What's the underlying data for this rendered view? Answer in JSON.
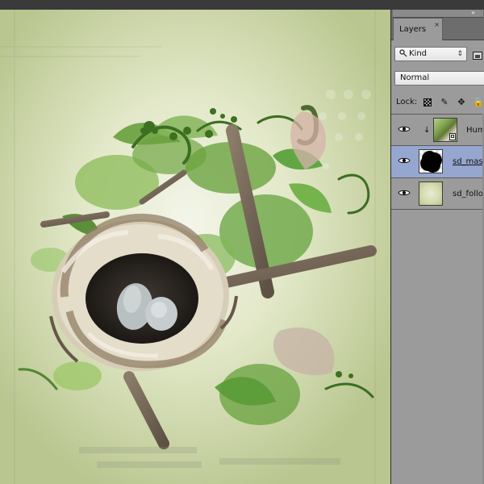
{
  "panel": {
    "tab_label": "Layers",
    "collapse_icon": "double-chevron-right-icon",
    "close_icon": "close-icon",
    "kind_label": "Kind",
    "blend_mode": "Normal",
    "lock_label": "Lock:",
    "lock_icons": [
      "lock-transparent-pixels-icon",
      "lock-image-pixels-icon",
      "lock-position-icon",
      "lock-all-icon"
    ]
  },
  "layers": [
    {
      "name": "Humm",
      "visible": true,
      "selected": false,
      "clipped": true,
      "thumbnail_type": "smart-object",
      "visibility_icon": "eye-icon",
      "clip_icon": "clip-arrow-icon",
      "smart_icon": "smart-object-icon"
    },
    {
      "name": "sd_mask",
      "visible": true,
      "selected": true,
      "clipped": false,
      "thumbnail_type": "mask",
      "visibility_icon": "eye-icon"
    },
    {
      "name": "sd_follow",
      "visible": true,
      "selected": false,
      "clipped": false,
      "thumbnail_type": "paper",
      "visibility_icon": "eye-icon"
    }
  ],
  "colors": {
    "panel_bg": "#9b9b9b",
    "selected_row": "#96a7cf",
    "header_bg": "#6d6d6d",
    "canvas_bg": "#dfe5c4",
    "canvas_green": "#7ea24f"
  }
}
